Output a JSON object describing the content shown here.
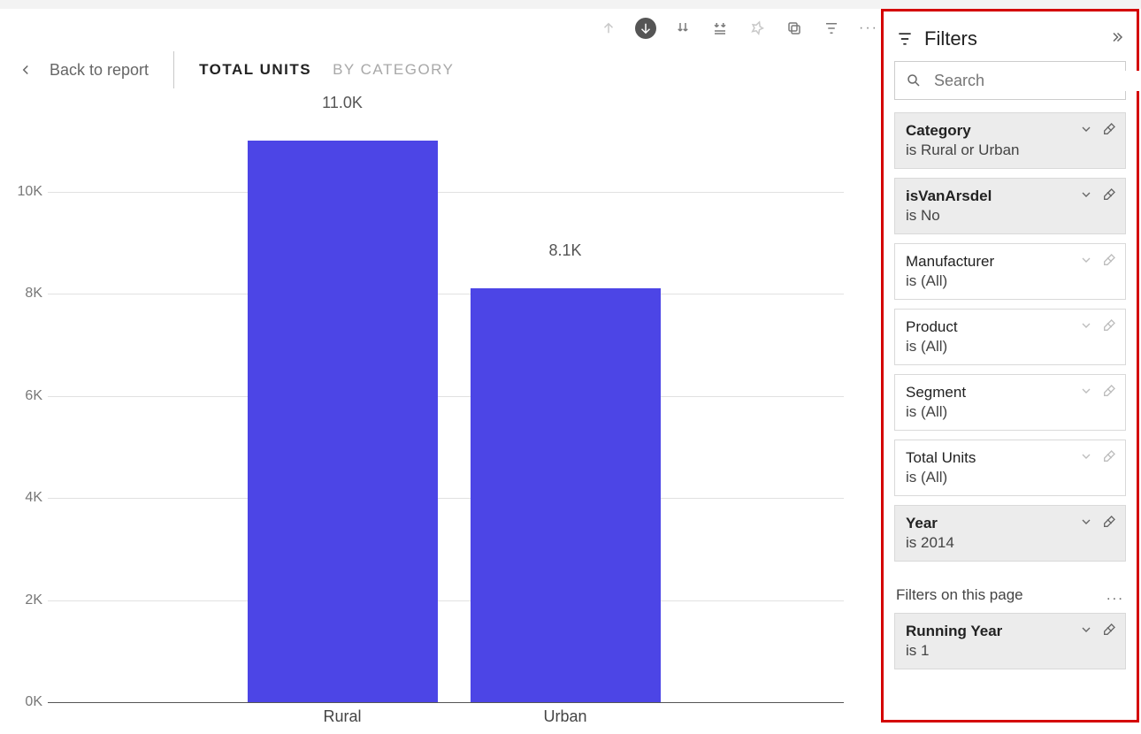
{
  "nav": {
    "back_label": "Back to report",
    "tabs": [
      {
        "label": "TOTAL UNITS",
        "active": true
      },
      {
        "label": "BY CATEGORY",
        "active": false
      }
    ]
  },
  "chart_data": {
    "type": "bar",
    "categories": [
      "Rural",
      "Urban"
    ],
    "values": [
      11000,
      8100
    ],
    "data_labels": [
      "11.0K",
      "8.1K"
    ],
    "ylim": [
      0,
      11000
    ],
    "y_ticks": [
      0,
      2000,
      4000,
      6000,
      8000,
      10000
    ],
    "y_tick_labels": [
      "0K",
      "2K",
      "4K",
      "6K",
      "8K",
      "10K"
    ],
    "title": "",
    "xlabel": "",
    "ylabel": "",
    "bar_color": "#4c45e6"
  },
  "filters": {
    "title": "Filters",
    "search_placeholder": "Search",
    "visual_filters": [
      {
        "name": "Category",
        "value": "is Rural or Urban",
        "active": true
      },
      {
        "name": "isVanArsdel",
        "value": "is No",
        "active": true
      },
      {
        "name": "Manufacturer",
        "value": "is (All)",
        "active": false
      },
      {
        "name": "Product",
        "value": "is (All)",
        "active": false
      },
      {
        "name": "Segment",
        "value": "is (All)",
        "active": false
      },
      {
        "name": "Total Units",
        "value": "is (All)",
        "active": false
      },
      {
        "name": "Year",
        "value": "is 2014",
        "active": true
      }
    ],
    "page_section_label": "Filters on this page",
    "page_filters": [
      {
        "name": "Running Year",
        "value": "is 1",
        "active": true
      }
    ]
  }
}
